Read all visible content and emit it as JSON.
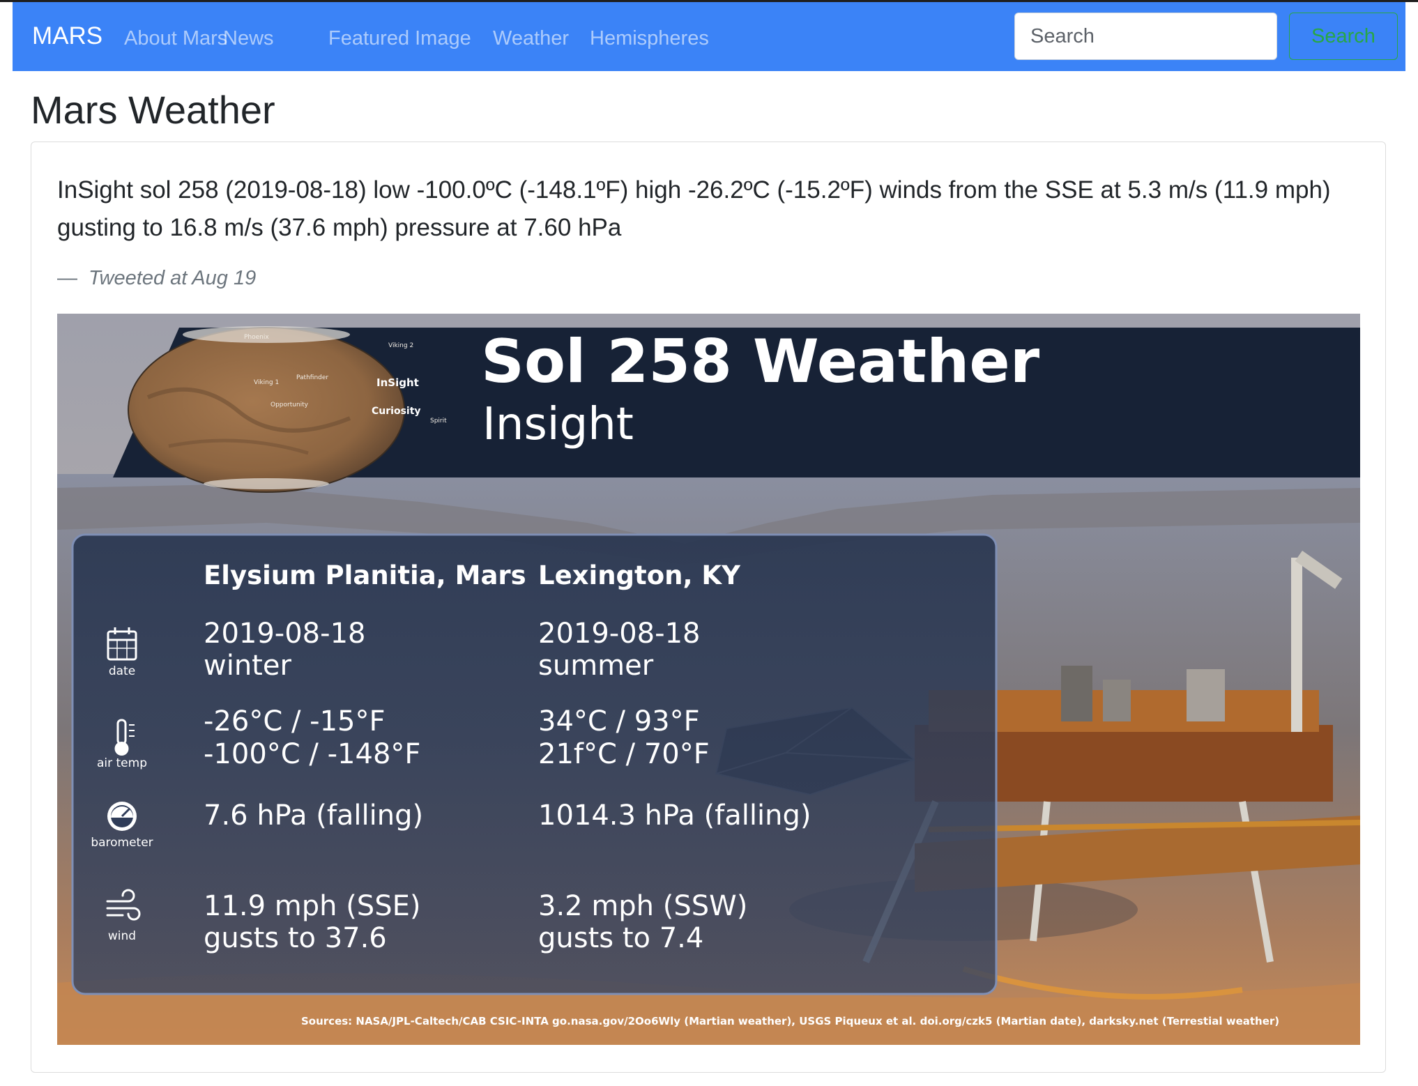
{
  "navbar": {
    "brand": "MARS",
    "links": [
      "About Mars",
      "News",
      "Featured Image",
      "Weather",
      "Hemispheres"
    ],
    "search_placeholder": "Search",
    "search_button": "Search"
  },
  "page": {
    "title": "Mars Weather"
  },
  "tweet": {
    "text": "InSight sol 258 (2019-08-18) low -100.0ºC (-148.1ºF) high -26.2ºC (-15.2ºF) winds from the SSE at 5.3 m/s (11.9 mph) gusting to 16.8 m/s (37.6 mph) pressure at 7.60 hPa",
    "footer_dash": "—",
    "footer_meta": "Tweeted at Aug 19"
  },
  "infographic": {
    "title": "Sol 258 Weather",
    "subtitle": "Insight",
    "map_labels": {
      "phoenix": "Phoenix",
      "viking2": "Viking 2",
      "viking1": "Viking 1",
      "pathfinder": "Pathfinder",
      "insight": "InSight",
      "opportunity": "Opportunity",
      "curiosity": "Curiosity",
      "spirit": "Spirit"
    },
    "columns": [
      "Elysium Planitia, Mars",
      "Lexington, KY"
    ],
    "rows": [
      {
        "icon": "calendar-icon",
        "label": "date",
        "mars": [
          "2019-08-18",
          "winter"
        ],
        "lex": [
          "2019-08-18",
          "summer"
        ]
      },
      {
        "icon": "thermometer-icon",
        "label": "air temp",
        "mars": [
          "-26°C / -15°F",
          "-100°C / -148°F"
        ],
        "lex": [
          "34°C / 93°F",
          "21f°C / 70°F"
        ]
      },
      {
        "icon": "barometer-icon",
        "label": "barometer",
        "mars": [
          "7.6 hPa (falling)"
        ],
        "lex": [
          "1014.3 hPa (falling)"
        ]
      },
      {
        "icon": "wind-icon",
        "label": "wind",
        "mars": [
          "11.9 mph (SSE)",
          "gusts to 37.6"
        ],
        "lex": [
          "3.2 mph (SSW)",
          "gusts to 7.4"
        ]
      }
    ],
    "sources": "Sources: NASA/JPL-Caltech/CAB CSIC-INTA go.nasa.gov/2Oo6Wly (Martian weather), USGS Piqueux et al. doi.org/czk5 (Martian date), darksky.net (Terrestial weather)"
  },
  "colors": {
    "navbar": "#3b83f7",
    "search_button": "#28a745",
    "banner": "#1a2438",
    "panel": "#2c3a55"
  }
}
